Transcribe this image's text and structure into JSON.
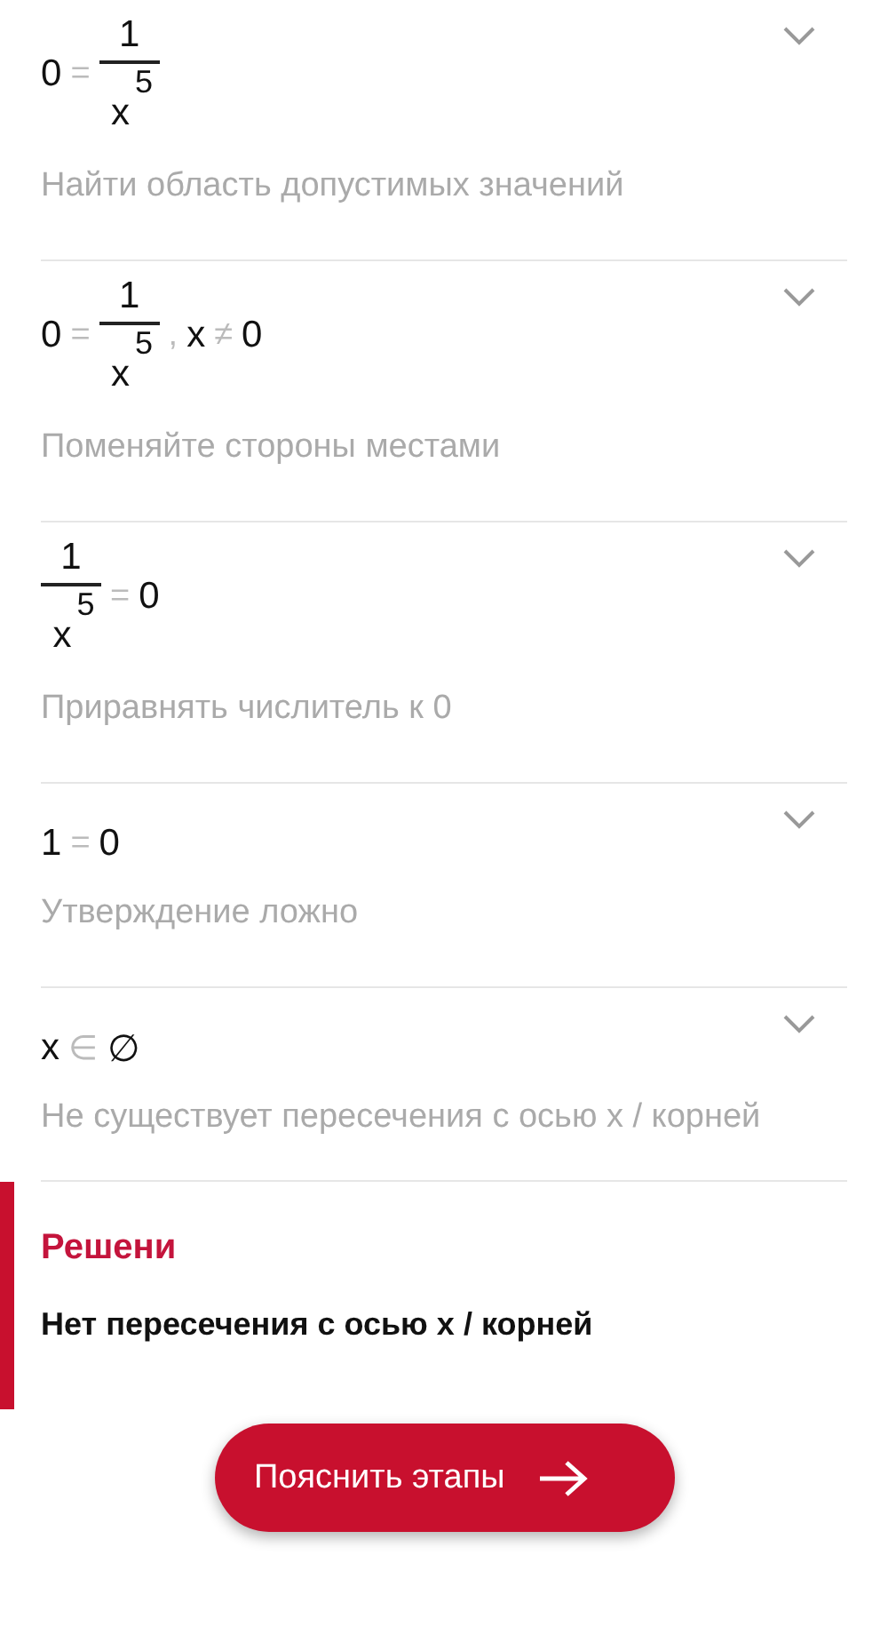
{
  "steps": [
    {
      "math": [
        {
          "kind": "text",
          "text": "0"
        },
        {
          "kind": "op",
          "text": "="
        },
        {
          "kind": "frac",
          "num": "1",
          "den": "x",
          "exp": "5"
        }
      ],
      "description": "Найти область допустимых значений",
      "expanded": false
    },
    {
      "math": [
        {
          "kind": "text",
          "text": "0"
        },
        {
          "kind": "op",
          "text": "="
        },
        {
          "kind": "frac",
          "num": "1",
          "den": "x",
          "exp": "5"
        },
        {
          "kind": "op",
          "text": ","
        },
        {
          "kind": "text",
          "text": "x"
        },
        {
          "kind": "op",
          "text": "≠"
        },
        {
          "kind": "text",
          "text": "0"
        }
      ],
      "description": "Поменяйте стороны местами",
      "expanded": false
    },
    {
      "math": [
        {
          "kind": "frac",
          "num": "1",
          "den": "x",
          "exp": "5"
        },
        {
          "kind": "op",
          "text": "="
        },
        {
          "kind": "text",
          "text": "0"
        }
      ],
      "description": "Приравнять числитель к 0",
      "expanded": false
    },
    {
      "math": [
        {
          "kind": "text",
          "text": "1"
        },
        {
          "kind": "op",
          "text": "="
        },
        {
          "kind": "text",
          "text": "0"
        }
      ],
      "description": "Утверждение ложно",
      "expanded": false
    },
    {
      "math": [
        {
          "kind": "text",
          "text": "x"
        },
        {
          "kind": "op",
          "text": "∈"
        },
        {
          "kind": "text",
          "text": "∅"
        }
      ],
      "description": "Не существует пересечения с осью x / корней",
      "expanded": false
    }
  ],
  "solution": {
    "heading": "Решени",
    "result": "Нет пересечения с осью x / корней"
  },
  "explain_button": {
    "label": "Пояснить этапы"
  }
}
